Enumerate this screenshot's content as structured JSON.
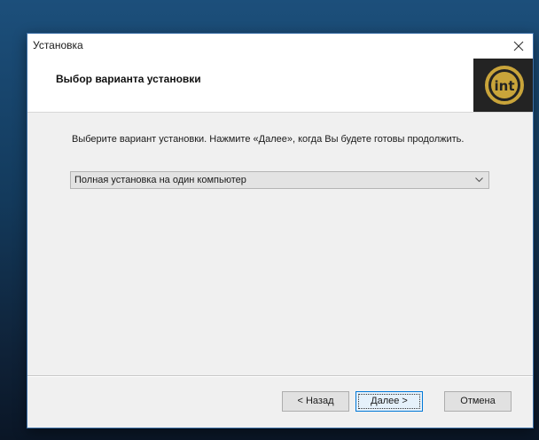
{
  "window": {
    "title": "Установка",
    "close_icon": "close-icon"
  },
  "header": {
    "title": "Выбор варианта установки",
    "logo_text": "int"
  },
  "content": {
    "description": "Выберите вариант установки. Нажмите «Далее», когда Вы будете готовы продолжить.",
    "install_option": {
      "selected": "Полная установка на один компьютер"
    }
  },
  "buttons": {
    "back": "< Назад",
    "next": "Далее >",
    "cancel": "Отмена"
  },
  "colors": {
    "dialog_bg": "#f0f0f0",
    "header_bg": "#ffffff",
    "logo_bg": "#232323",
    "logo_gold": "#c9a43a",
    "accent": "#0078d7"
  }
}
